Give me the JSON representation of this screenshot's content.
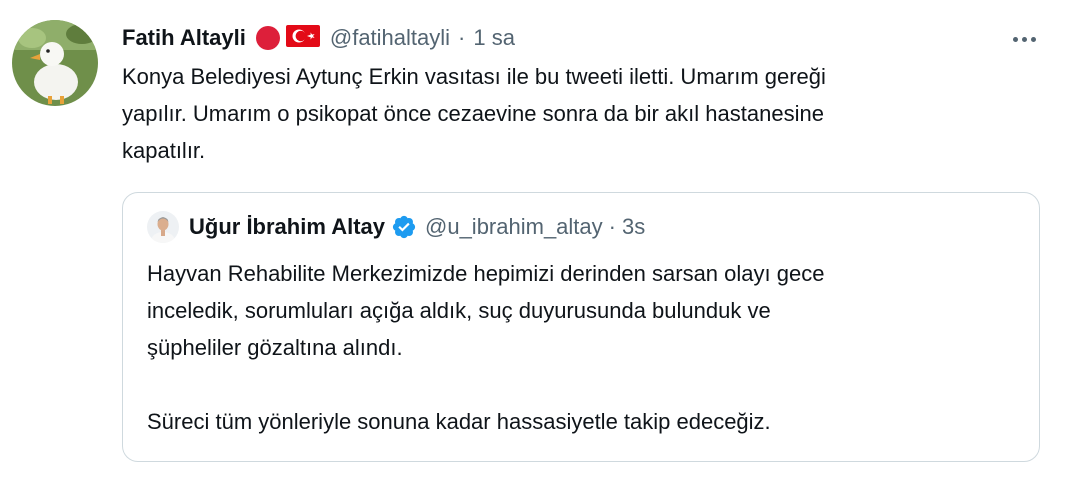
{
  "tweet": {
    "display_name": "Fatih Altayli",
    "handle": "@fatihaltayli",
    "separator": "·",
    "time": "1 sa",
    "text_lines": [
      "Konya Belediyesi Aytunç Erkin vasıtası ile bu tweeti iletti. Umarım gereği",
      "yapılır.  Umarım o psikopat önce cezaevine sonra da bir akıl hastanesine",
      "kapatılır."
    ],
    "icons": {
      "avatar": "duck-avatar-icon",
      "badge": "red-circle-icon",
      "flag": "turkey-flag-icon",
      "more": "more-options-icon"
    }
  },
  "quote": {
    "display_name": "Uğur İbrahim Altay",
    "handle": "@u_ibrahim_altay",
    "separator": "·",
    "time": "3s",
    "paragraph1_lines": [
      "Hayvan Rehabilite Merkezimizde hepimizi derinden sarsan olayı gece",
      "inceledik, sorumluları açığa aldık, suç duyurusunda bulunduk ve",
      "şüpheliler gözaltına alındı."
    ],
    "paragraph2": "Süreci tüm yönleriyle sonuna kadar hassasiyetle takip edeceğiz.",
    "icons": {
      "avatar": "person-avatar-icon",
      "verified": "verified-badge-icon"
    }
  },
  "colors": {
    "text": "#0f1419",
    "secondary": "#536471",
    "border": "#cfd9de",
    "verified": "#1d9bf0",
    "red": "#dd1f3a"
  }
}
